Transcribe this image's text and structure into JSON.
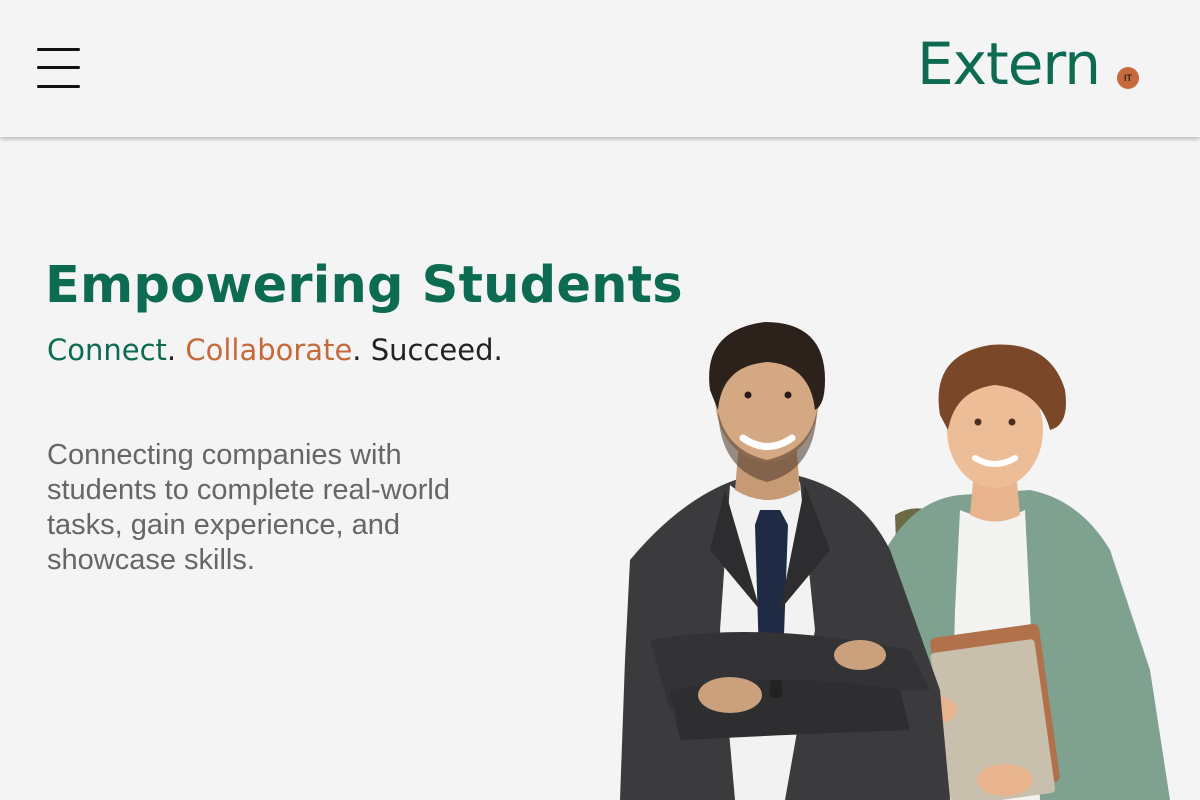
{
  "header": {
    "menu_icon": "hamburger-menu-icon",
    "logo": {
      "text": "Extern",
      "badge": "IT"
    }
  },
  "hero": {
    "title": "Empowering Students",
    "tagline": {
      "word1": "Connect",
      "word2": "Collaborate",
      "word3": "Succeed",
      "separator": ".",
      "colors": {
        "word1": "#0d6b52",
        "word2": "#c66a3b",
        "word3": "#222222"
      }
    },
    "description": "Connecting companies with students to complete real-world tasks, gain experience, and showcase skills."
  },
  "colors": {
    "brand_green": "#0d6b52",
    "accent_orange": "#c66a3b",
    "background": "#f4f4f4",
    "body_text": "#666666"
  }
}
